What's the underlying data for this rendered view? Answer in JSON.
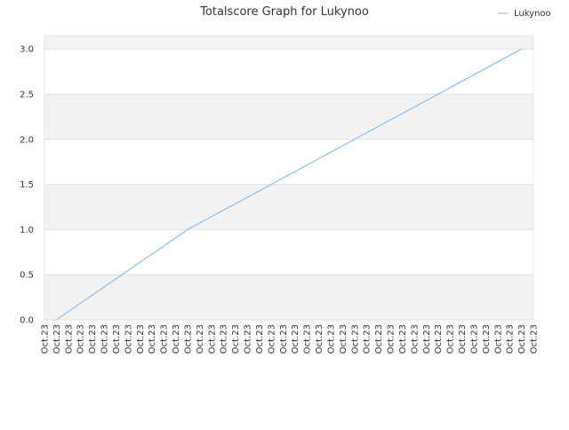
{
  "chart_data": {
    "type": "line",
    "title": "Totalscore Graph for Lukynoo",
    "xlabel": "",
    "ylabel": "",
    "ylim": [
      0,
      3.15
    ],
    "yticks": [
      0.0,
      0.5,
      1.0,
      1.5,
      2.0,
      2.5,
      3.0
    ],
    "ytick_labels": [
      "0.0",
      "0.5",
      "1.0",
      "1.5",
      "2.0",
      "2.5",
      "3.0"
    ],
    "categories": [
      "Oct.23",
      "Oct.23",
      "Oct.23",
      "Oct.23",
      "Oct.23",
      "Oct.23",
      "Oct.23",
      "Oct.23",
      "Oct.23",
      "Oct.23",
      "Oct.23",
      "Oct.23",
      "Oct.23",
      "Oct.23",
      "Oct.23",
      "Oct.23",
      "Oct.23",
      "Oct.23",
      "Oct.23",
      "Oct.23",
      "Oct.23",
      "Oct.23",
      "Oct.23",
      "Oct.23",
      "Oct.23",
      "Oct.23",
      "Oct.23",
      "Oct.23",
      "Oct.23",
      "Oct.23",
      "Oct.23",
      "Oct.23",
      "Oct.23",
      "Oct.23",
      "Oct.23",
      "Oct.23",
      "Oct.23",
      "Oct.23",
      "Oct.23",
      "Oct.23",
      "Oct.23",
      "Oct.23"
    ],
    "series": [
      {
        "name": "Lukynoo",
        "color": "#7cb5ec",
        "points": [
          [
            1,
            0.0
          ],
          [
            12,
            1.0
          ],
          [
            40,
            3.0
          ]
        ]
      }
    ],
    "grid": true,
    "band_color": "#f2f2f2",
    "legend": "top-right"
  }
}
